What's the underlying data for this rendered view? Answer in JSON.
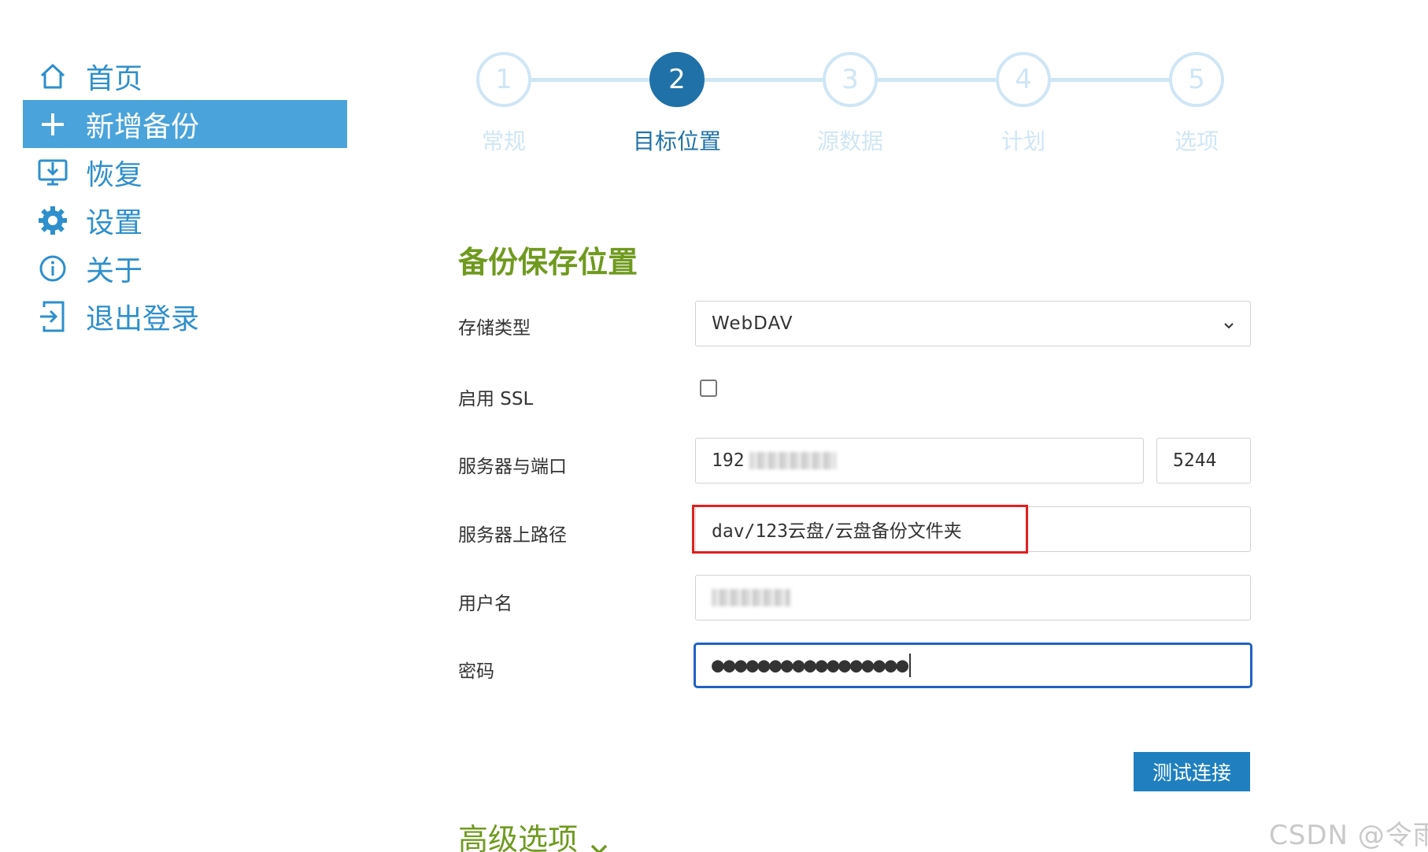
{
  "sidebar": {
    "items": [
      {
        "label": "首页",
        "icon": "home-icon"
      },
      {
        "label": "新增备份",
        "icon": "plus-icon",
        "active": true
      },
      {
        "label": "恢复",
        "icon": "restore-icon"
      },
      {
        "label": "设置",
        "icon": "gear-icon"
      },
      {
        "label": "关于",
        "icon": "info-icon"
      },
      {
        "label": "退出登录",
        "icon": "logout-icon"
      }
    ]
  },
  "stepper": {
    "current": 2,
    "steps": [
      {
        "number": "1",
        "label": "常规"
      },
      {
        "number": "2",
        "label": "目标位置"
      },
      {
        "number": "3",
        "label": "源数据"
      },
      {
        "number": "4",
        "label": "计划"
      },
      {
        "number": "5",
        "label": "选项"
      }
    ]
  },
  "section": {
    "title": "备份保存位置"
  },
  "form": {
    "storage_type": {
      "label": "存储类型",
      "value": "WebDAV"
    },
    "ssl": {
      "label": "启用 SSL",
      "checked": false
    },
    "server": {
      "label": "服务器与端口",
      "host_prefix": "192",
      "port": "5244"
    },
    "path": {
      "label": "服务器上路径",
      "value": "dav/123云盘/云盘备份文件夹"
    },
    "username": {
      "label": "用户名"
    },
    "password": {
      "label": "密码",
      "masked_value": "●●●●●●●●●●●●●●●●●"
    }
  },
  "actions": {
    "test_connection": "测试连接"
  },
  "advanced": {
    "label": "高级选项"
  },
  "watermark": "CSDN @令雨",
  "colors": {
    "accent_blue": "#4aa3db",
    "step_active": "#2071a8",
    "step_inactive": "#cfe6f5",
    "section_green": "#6f9a1f",
    "highlight_red": "#e0201f",
    "button_blue": "#1f7fbf"
  }
}
